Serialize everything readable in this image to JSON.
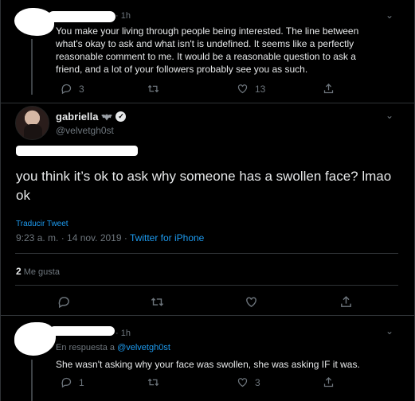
{
  "reply1": {
    "time": "· 1h",
    "text_lines": [
      "You make your living through people being interested.  The line between",
      "what's okay to ask and what isn't is undefined.  It seems like a perfectly",
      "reasonable comment to me.  It would be a reasonable question to ask a",
      "friend, and a lot of your followers probably see you as such."
    ],
    "reply_count": "3",
    "retweet_count": "",
    "like_count": "13"
  },
  "main_tweet": {
    "name": "gabriella",
    "handle": "@velvetgh0st",
    "text": "you think it’s ok to ask why someone has a swollen face? lmao ok",
    "translate_label": "Traducir Tweet",
    "time": "9:23 a. m. · 14 nov. 2019 · ",
    "client": "Twitter for iPhone",
    "likes_count": "2",
    "likes_label": "Me gusta"
  },
  "reply2": {
    "time": "· 1h",
    "reply_to_prefix": "En respuesta a ",
    "reply_to_handle": "@velvetgh0st",
    "text": "She wasn't asking why your face was swollen, she was asking IF it was.",
    "reply_count": "1",
    "retweet_count": "",
    "like_count": "3"
  },
  "icons": {
    "reply": "reply-icon",
    "retweet": "retweet-icon",
    "like": "heart-icon",
    "share": "share-icon",
    "caret": "chevron-down-icon",
    "verified": "verified-badge-icon",
    "emoji": "bat-emoji-icon"
  }
}
